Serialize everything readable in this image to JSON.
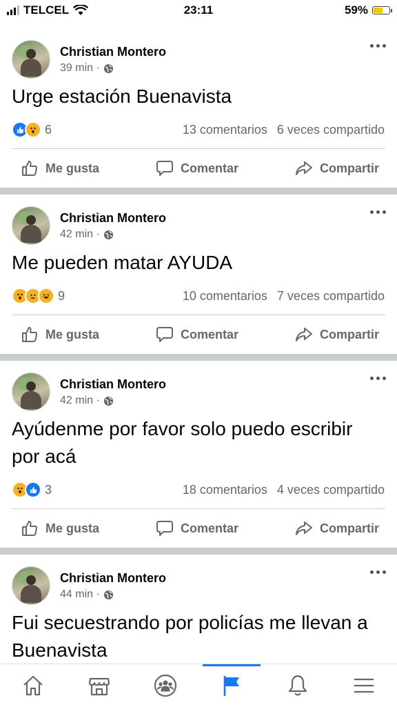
{
  "status_bar": {
    "carrier": "TELCEL",
    "time": "23:11",
    "battery": "59%",
    "battery_level": 0.59
  },
  "posts": [
    {
      "author": "Christian Montero",
      "time": "39 min · ",
      "text": "Urge estación Buenavista",
      "reactions": [
        "like",
        "wow"
      ],
      "reaction_count": "6",
      "comments": "13 comentarios",
      "shares": "6 veces compartido"
    },
    {
      "author": "Christian Montero",
      "time": "42 min · ",
      "text": "Me pueden matar AYUDA",
      "reactions": [
        "wow",
        "sad",
        "haha"
      ],
      "reaction_count": "9",
      "comments": "10 comentarios",
      "shares": "7 veces compartido"
    },
    {
      "author": "Christian Montero",
      "time": "42 min · ",
      "text": "Ayúdenme por favor solo puedo escribir por acá",
      "reactions": [
        "wow",
        "like"
      ],
      "reaction_count": "3",
      "comments": "18 comentarios",
      "shares": "4 veces compartido"
    },
    {
      "author": "Christian Montero",
      "time": "44 min · ",
      "text": "Fui secuestrando por policías me llevan a Buenavista",
      "reactions": [],
      "reaction_count": "",
      "comments": "",
      "shares": ""
    }
  ],
  "actions": {
    "like": "Me gusta",
    "comment": "Comentar",
    "share": "Compartir"
  },
  "nav": [
    "home-icon",
    "marketplace-icon",
    "groups-icon",
    "pages-flag-icon",
    "notifications-bell-icon",
    "menu-icon"
  ],
  "colors": {
    "accent": "#1877f2",
    "secondary_text": "#65676b",
    "separator": "#c9ccd1",
    "battery": "#f5c400"
  }
}
